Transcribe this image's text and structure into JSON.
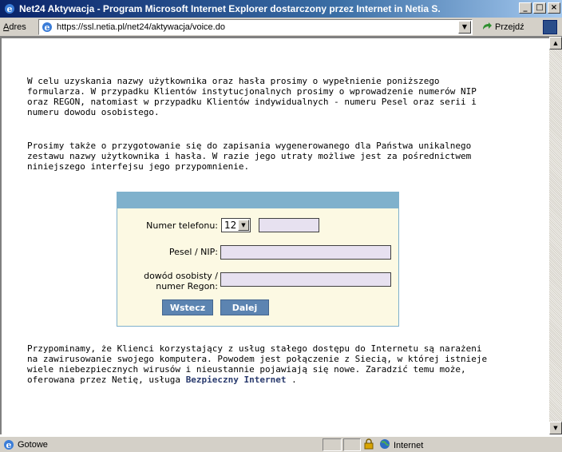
{
  "window": {
    "title": "Net24 Aktywacja - Program Microsoft Internet Explorer dostarczony przez Internet in Netia S.",
    "minimize": "_",
    "maximize": "□",
    "close": "×"
  },
  "address_bar": {
    "label_underlined": "A",
    "label_rest": "dres",
    "url": "https://ssl.netia.pl/net24/aktywacja/voice.do",
    "go_label": "Przejdź"
  },
  "content": {
    "paragraph1": "W celu uzyskania nazwy użytkownika oraz hasła prosimy o wypełnienie poniższego formularza. W przypadku Klientów instytucjonalnych prosimy o wprowadzenie numerów NIP oraz REGON, natomiast w przypadku Klientów indywidualnych - numeru Pesel oraz serii i numeru dowodu osobistego.",
    "paragraph2": "Prosimy także o przygotowanie się do zapisania wygenerowanego dla Państwa unikalnego zestawu nazwy użytkownika i hasła. W razie jego utraty możliwe jest za pośrednictwem niniejszego interfejsu jego przypomnienie.",
    "paragraph3_before": "Przypominamy, że Klienci korzystający z usług stałego dostępu do Internetu są narażeni na zawirusowanie swojego komputera. Powodem jest połączenie z Siecią, w której istnieje wiele niebezpiecznych wirusów i nieustannie pojawiają się nowe. Zaradzić temu może, oferowana przez Netię, usługa ",
    "paragraph3_link": "Bezpieczny Internet",
    "paragraph3_after": " ."
  },
  "form": {
    "phone_label": "Numer telefonu:",
    "phone_prefix_value": "12",
    "phone_number_value": "",
    "pesel_label": "Pesel / NIP:",
    "pesel_value": "",
    "id_label_line1": "dowód osobisty /",
    "id_label_line2": "numer Regon:",
    "id_value": "",
    "back_button": "Wstecz",
    "next_button": "Dalej"
  },
  "status_bar": {
    "status_text": "Gotowe",
    "zone": "Internet"
  }
}
